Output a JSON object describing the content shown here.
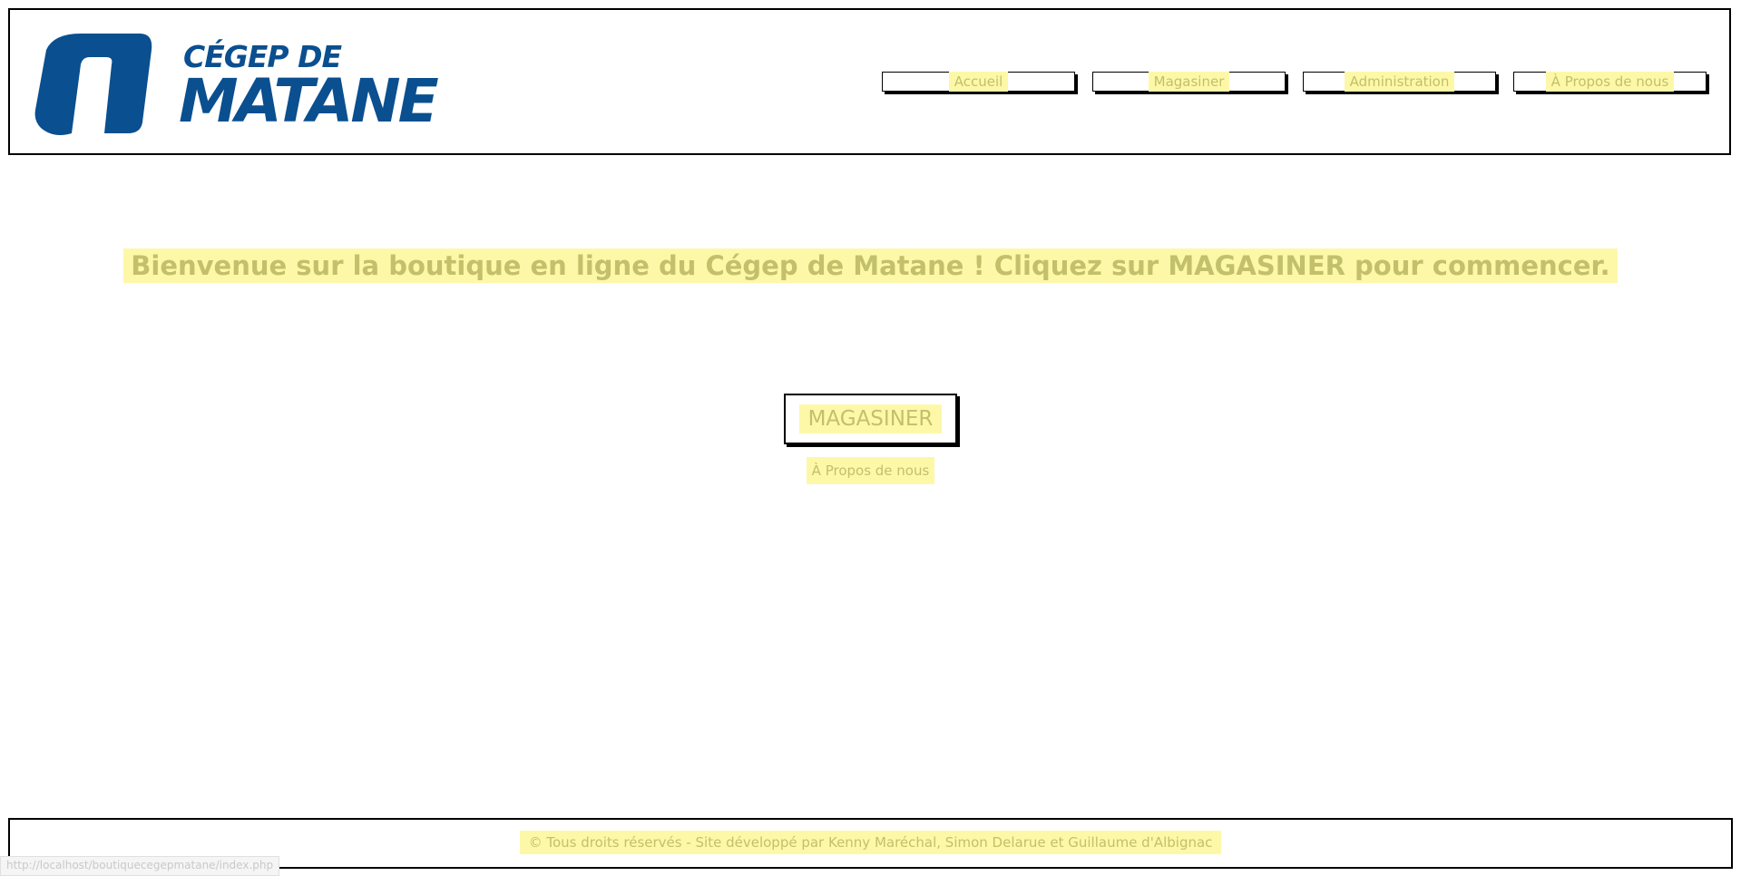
{
  "header": {
    "logo": {
      "line1": "CÉGEP DE",
      "line2": "MATANE",
      "color": "#0a4f8f"
    },
    "nav": [
      {
        "label": "Accueil"
      },
      {
        "label": "Magasiner"
      },
      {
        "label": "Administration"
      },
      {
        "label": "À Propos de nous"
      }
    ]
  },
  "main": {
    "welcome": "Bienvenue sur la boutique en ligne du Cégep de Matane ! Cliquez sur MAGASINER pour commencer.",
    "cta_label": "MAGASINER",
    "about_link": "À Propos de nous"
  },
  "footer": {
    "text": "© Tous droits réservés - Site développé par Kenny Maréchal, Simon Delarue et Guillaume d'Albignac"
  },
  "statusbar": {
    "url": "http://localhost/boutiquecegepmatane/index.php"
  },
  "colors": {
    "highlight": "#fdf8a8",
    "text": "#c2c06a",
    "brand": "#0a4f8f"
  }
}
